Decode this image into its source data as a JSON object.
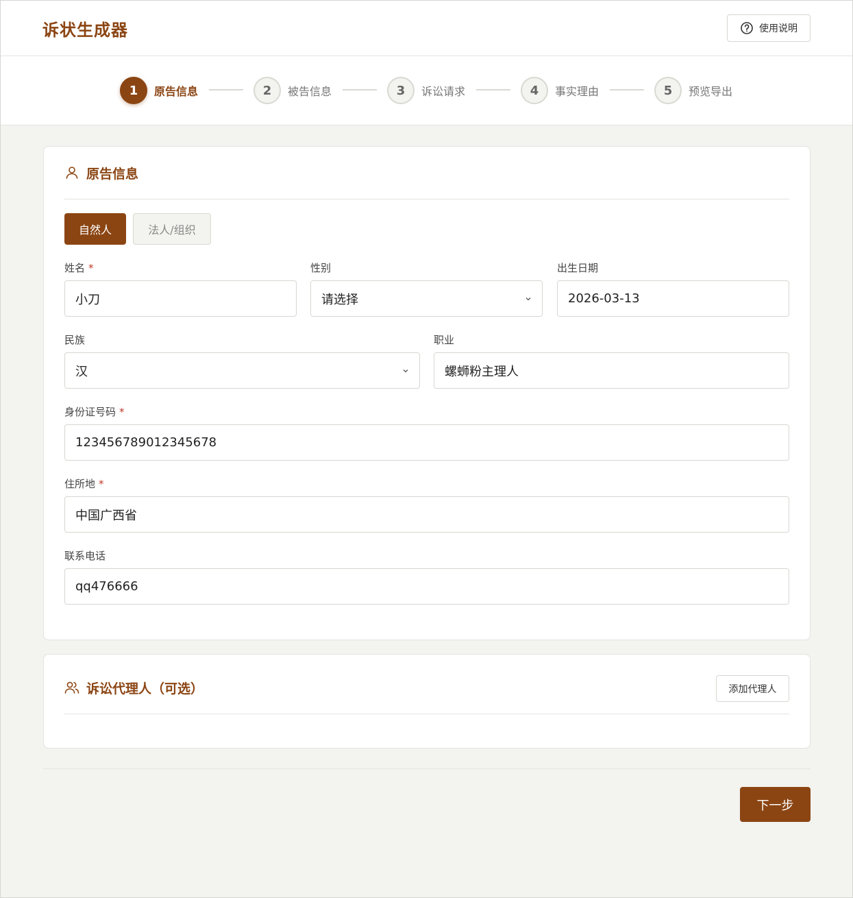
{
  "header": {
    "title": "诉状生成器",
    "help_label": "使用说明"
  },
  "steps": [
    {
      "number": "1",
      "label": "原告信息",
      "active": true
    },
    {
      "number": "2",
      "label": "被告信息",
      "active": false
    },
    {
      "number": "3",
      "label": "诉讼请求",
      "active": false
    },
    {
      "number": "4",
      "label": "事实理由",
      "active": false
    },
    {
      "number": "5",
      "label": "预览导出",
      "active": false
    }
  ],
  "plaintiff": {
    "title": "原告信息",
    "type_tabs": {
      "natural": "自然人",
      "legal": "法人/组织",
      "selected": "自然人"
    },
    "required_mark": "*",
    "fields": {
      "name": {
        "label": "姓名",
        "value": "小刀"
      },
      "gender": {
        "label": "性别",
        "value": "请选择"
      },
      "birthdate": {
        "label": "出生日期",
        "value": "2026-03-13"
      },
      "ethnicity": {
        "label": "民族",
        "value": "汉"
      },
      "occupation": {
        "label": "职业",
        "value": "螺蛳粉主理人"
      },
      "id_number": {
        "label": "身份证号码",
        "value": "123456789012345678"
      },
      "address": {
        "label": "住所地",
        "value": "中国广西省"
      },
      "phone": {
        "label": "联系电话",
        "value": "qq476666"
      }
    }
  },
  "agent": {
    "title": "诉讼代理人（可选）",
    "add_label": "添加代理人"
  },
  "footer": {
    "next_label": "下一步"
  },
  "colors": {
    "accent": "#8b4513",
    "background": "#f3f3ef",
    "required": "#c0392b"
  },
  "icons": {
    "help": "help-circle-icon",
    "plaintiff": "user-icon",
    "agent": "users-icon",
    "select": "chevron-down-icon"
  }
}
